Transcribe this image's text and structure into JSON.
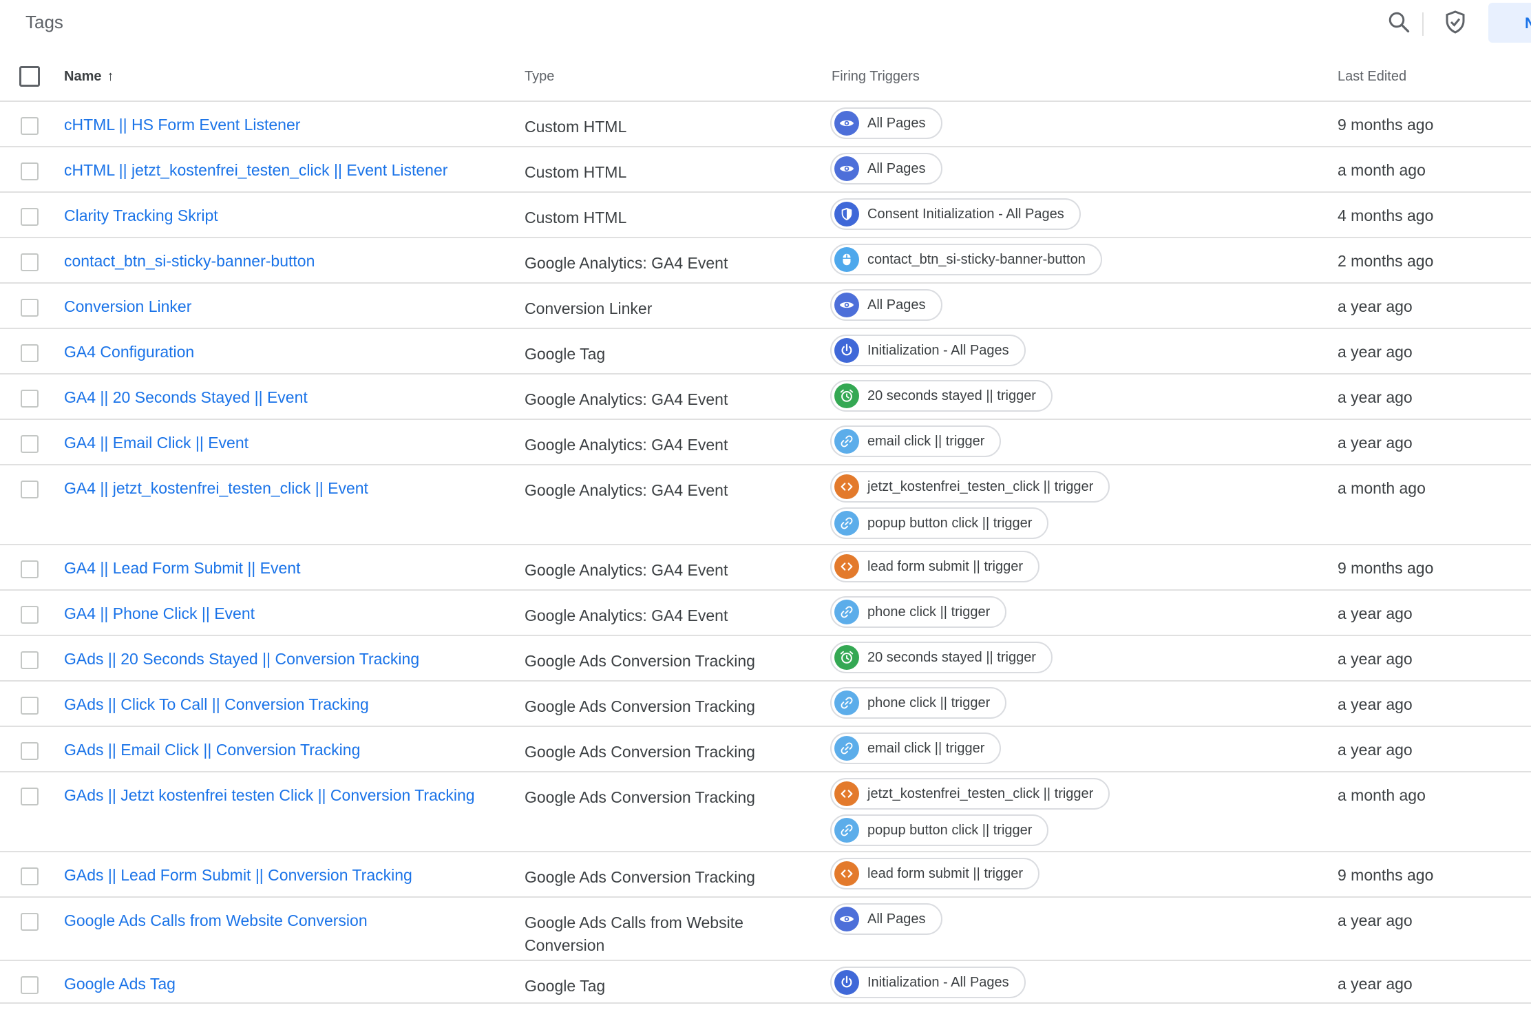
{
  "header": {
    "title": "Tags",
    "new_button_label": "Ne"
  },
  "columns": {
    "name": "Name",
    "type": "Type",
    "triggers": "Firing Triggers",
    "last_edited": "Last Edited",
    "sort_indicator": "↑"
  },
  "colors": {
    "link": "#1a73e8",
    "pageview": "#4d6fd9",
    "consent": "#3f68d8",
    "init": "#3f68d8",
    "click": "#4ea8ec",
    "link_click": "#5cadea",
    "timer": "#34a853",
    "custom_event": "#e37a2c"
  },
  "rows": [
    {
      "name": "cHTML || HS Form Event Listener",
      "type": "Custom HTML",
      "last_edited": "9 months ago",
      "triggers": [
        {
          "label": "All Pages",
          "icon": "eye-icon",
          "kind": "pageview"
        }
      ]
    },
    {
      "name": "cHTML || jetzt_kostenfrei_testen_click || Event Listener",
      "type": "Custom HTML",
      "last_edited": "a month ago",
      "triggers": [
        {
          "label": "All Pages",
          "icon": "eye-icon",
          "kind": "pageview"
        }
      ]
    },
    {
      "name": "Clarity Tracking Skript",
      "type": "Custom HTML",
      "last_edited": "4 months ago",
      "triggers": [
        {
          "label": "Consent Initialization - All Pages",
          "icon": "shield-icon",
          "kind": "consent"
        }
      ]
    },
    {
      "name": "contact_btn_si-sticky-banner-button",
      "type": "Google Analytics: GA4 Event",
      "last_edited": "2 months ago",
      "triggers": [
        {
          "label": "contact_btn_si-sticky-banner-button",
          "icon": "mouse-icon",
          "kind": "click"
        }
      ]
    },
    {
      "name": "Conversion Linker",
      "type": "Conversion Linker",
      "last_edited": "a year ago",
      "triggers": [
        {
          "label": "All Pages",
          "icon": "eye-icon",
          "kind": "pageview"
        }
      ]
    },
    {
      "name": "GA4 Configuration",
      "type": "Google Tag",
      "last_edited": "a year ago",
      "triggers": [
        {
          "label": "Initialization - All Pages",
          "icon": "power-icon",
          "kind": "init"
        }
      ]
    },
    {
      "name": "GA4 || 20 Seconds Stayed || Event",
      "type": "Google Analytics: GA4 Event",
      "last_edited": "a year ago",
      "triggers": [
        {
          "label": "20 seconds stayed || trigger",
          "icon": "alarm-icon",
          "kind": "timer"
        }
      ]
    },
    {
      "name": "GA4 || Email Click || Event",
      "type": "Google Analytics: GA4 Event",
      "last_edited": "a year ago",
      "triggers": [
        {
          "label": "email click || trigger",
          "icon": "link-icon",
          "kind": "link_click"
        }
      ]
    },
    {
      "name": "GA4 || jetzt_kostenfrei_testen_click || Event",
      "type": "Google Analytics: GA4 Event",
      "last_edited": "a month ago",
      "triggers": [
        {
          "label": "jetzt_kostenfrei_testen_click || trigger",
          "icon": "code-icon",
          "kind": "custom_event"
        },
        {
          "label": "popup button click || trigger",
          "icon": "link-icon",
          "kind": "link_click"
        }
      ]
    },
    {
      "name": "GA4 || Lead Form Submit || Event",
      "type": "Google Analytics: GA4 Event",
      "last_edited": "9 months ago",
      "triggers": [
        {
          "label": "lead form submit || trigger",
          "icon": "code-icon",
          "kind": "custom_event"
        }
      ]
    },
    {
      "name": "GA4 || Phone Click || Event",
      "type": "Google Analytics: GA4 Event",
      "last_edited": "a year ago",
      "triggers": [
        {
          "label": "phone click || trigger",
          "icon": "link-icon",
          "kind": "link_click"
        }
      ]
    },
    {
      "name": "GAds || 20 Seconds Stayed || Conversion Tracking",
      "type": "Google Ads Conversion Tracking",
      "last_edited": "a year ago",
      "triggers": [
        {
          "label": "20 seconds stayed || trigger",
          "icon": "alarm-icon",
          "kind": "timer"
        }
      ]
    },
    {
      "name": "GAds || Click To Call || Conversion Tracking",
      "type": "Google Ads Conversion Tracking",
      "last_edited": "a year ago",
      "triggers": [
        {
          "label": "phone click || trigger",
          "icon": "link-icon",
          "kind": "link_click"
        }
      ]
    },
    {
      "name": "GAds || Email Click || Conversion Tracking",
      "type": "Google Ads Conversion Tracking",
      "last_edited": "a year ago",
      "triggers": [
        {
          "label": "email click || trigger",
          "icon": "link-icon",
          "kind": "link_click"
        }
      ]
    },
    {
      "name": "GAds || Jetzt kostenfrei testen Click || Conversion Tracking",
      "type": "Google Ads Conversion Tracking",
      "last_edited": "a month ago",
      "triggers": [
        {
          "label": "jetzt_kostenfrei_testen_click || trigger",
          "icon": "code-icon",
          "kind": "custom_event"
        },
        {
          "label": "popup button click || trigger",
          "icon": "link-icon",
          "kind": "link_click"
        }
      ]
    },
    {
      "name": "GAds || Lead Form Submit || Conversion Tracking",
      "type": "Google Ads Conversion Tracking",
      "last_edited": "9 months ago",
      "triggers": [
        {
          "label": "lead form submit || trigger",
          "icon": "code-icon",
          "kind": "custom_event"
        }
      ]
    },
    {
      "name": "Google Ads Calls from Website Conversion",
      "type": "Google Ads Calls from Website Conversion",
      "last_edited": "a year ago",
      "triggers": [
        {
          "label": "All Pages",
          "icon": "eye-icon",
          "kind": "pageview"
        }
      ]
    },
    {
      "name": "Google Ads Tag",
      "type": "Google Tag",
      "last_edited": "a year ago",
      "triggers": [
        {
          "label": "Initialization - All Pages",
          "icon": "power-icon",
          "kind": "init"
        }
      ]
    }
  ]
}
